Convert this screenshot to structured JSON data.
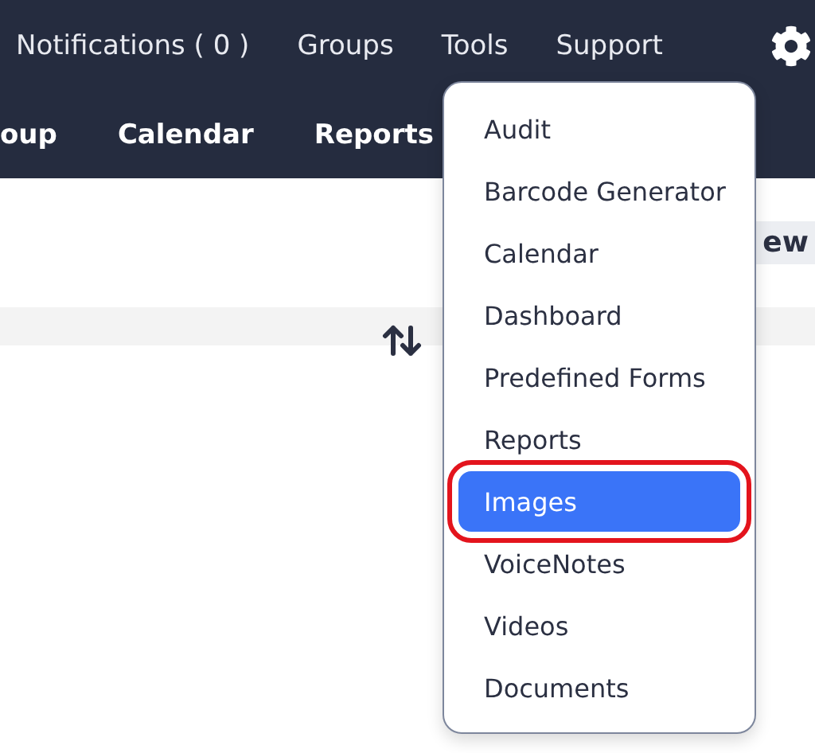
{
  "top_nav": [
    "Notifications ( 0 )",
    "Groups",
    "Tools",
    "Support"
  ],
  "sub_nav": [
    "oup",
    "Calendar",
    "Reports"
  ],
  "toolbar": {
    "button": "ew"
  },
  "tools_menu": [
    {
      "label": "Audit",
      "selected": false
    },
    {
      "label": "Barcode Generator",
      "selected": false
    },
    {
      "label": "Calendar",
      "selected": false
    },
    {
      "label": "Dashboard",
      "selected": false
    },
    {
      "label": "Predefined Forms",
      "selected": false
    },
    {
      "label": "Reports",
      "selected": false
    },
    {
      "label": "Images",
      "selected": true
    },
    {
      "label": "VoiceNotes",
      "selected": false
    },
    {
      "label": "Videos",
      "selected": false
    },
    {
      "label": "Documents",
      "selected": false
    }
  ]
}
